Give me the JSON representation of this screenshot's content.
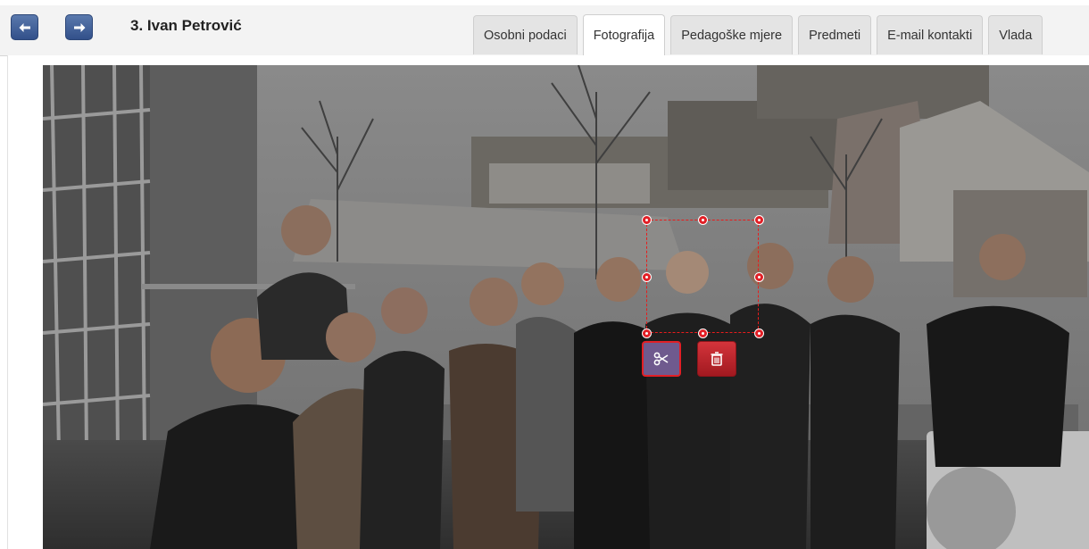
{
  "header": {
    "title": "3. Ivan Petrović",
    "back_icon": "arrow-left-icon",
    "forward_icon": "arrow-right-icon"
  },
  "tabs": [
    {
      "label": "Osobni podaci",
      "active": false
    },
    {
      "label": "Fotografija",
      "active": true
    },
    {
      "label": "Pedagoške mjere",
      "active": false
    },
    {
      "label": "Predmeti",
      "active": false
    },
    {
      "label": "E-mail kontakti",
      "active": false
    },
    {
      "label": "Vlada",
      "active": false
    }
  ],
  "photo": {
    "description_icon": "group-photo",
    "crop_tool": {
      "crop_icon": "scissors-icon",
      "delete_icon": "trash-icon"
    }
  },
  "colors": {
    "nav_button": "#3d5a91",
    "crop_border": "#e21f26",
    "delete_button": "#c0262d",
    "crop_button": "#6f5a8e"
  }
}
